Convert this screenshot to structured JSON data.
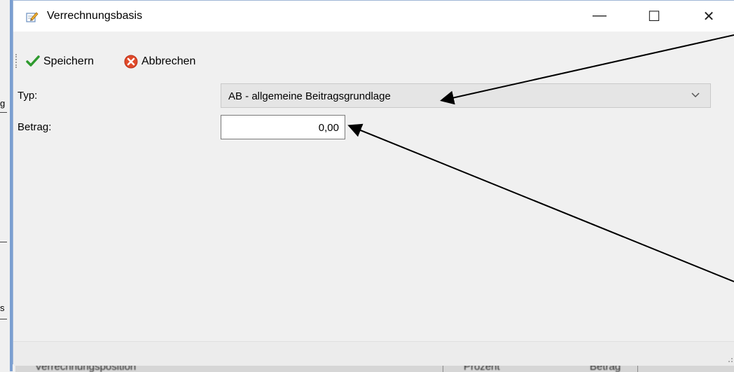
{
  "window": {
    "title": "Verrechnungsbasis",
    "controls": {
      "minimize": "—",
      "maximize": "☐",
      "close": "✕"
    }
  },
  "toolbar": {
    "save_label": "Speichern",
    "cancel_label": "Abbrechen"
  },
  "form": {
    "typ_label": "Typ:",
    "typ_value": "AB - allgemeine Beitragsgrundlage",
    "betrag_label": "Betrag:",
    "betrag_value": "0,00"
  },
  "background": {
    "frag_g": "g",
    "frag_s": "s",
    "column_1": "Verrechnungsposition",
    "column_2": "Prozent",
    "column_3": "Betrag"
  },
  "colors": {
    "window_bg": "#f0f0f0",
    "titlebar_bg": "#ffffff",
    "combo_bg": "#e5e5e5",
    "accent_blue": "#7b9fd1",
    "save_icon": "#2e9a2e",
    "cancel_icon": "#e04a2a"
  },
  "icons": {
    "title": "edit-document-icon",
    "save": "checkmark-icon",
    "cancel": "cancel-icon",
    "dropdown": "chevron-down-icon"
  }
}
